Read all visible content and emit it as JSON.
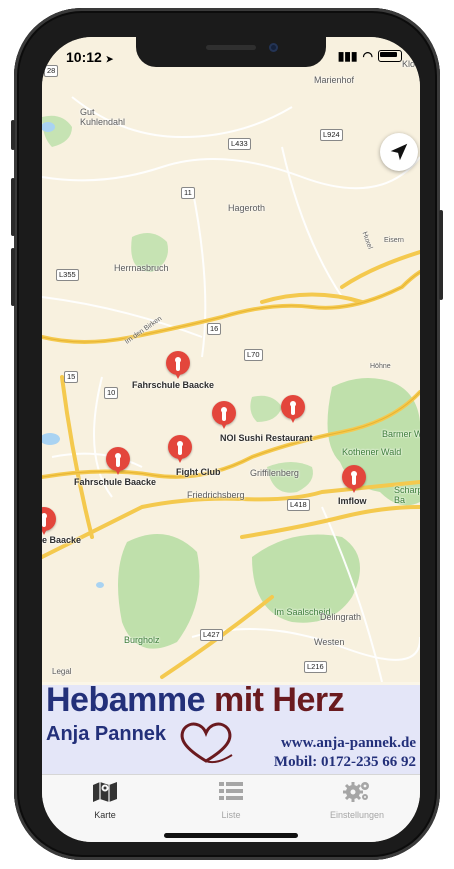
{
  "status_bar": {
    "time": "10:12",
    "location_arrow": "location-arrow-icon"
  },
  "map": {
    "places": [
      {
        "name": "Marienhof"
      },
      {
        "name": "Gut\nKuhlendahl"
      },
      {
        "name": "Hageroth"
      },
      {
        "name": "Herrnasbruch"
      },
      {
        "name": "Griffilenberg"
      },
      {
        "name": "Friedrichsberg"
      },
      {
        "name": "Kothener Wald"
      },
      {
        "name": "Barmer W"
      },
      {
        "name": "Im Saalscheid"
      },
      {
        "name": "Delingrath"
      },
      {
        "name": "Westen"
      },
      {
        "name": "Burgholz"
      },
      {
        "name": "Scharp\nBa"
      },
      {
        "name": "Klo"
      },
      {
        "name": "Legal"
      },
      {
        "name": "Huxel"
      },
      {
        "name": "Eisern"
      },
      {
        "name": "Höhne"
      },
      {
        "name": "Im den Birken"
      }
    ],
    "roads": [
      "28",
      "L924",
      "L433",
      "11",
      "L355",
      "16",
      "L70",
      "15",
      "10",
      "L418",
      "L427",
      "L216"
    ],
    "pins": [
      {
        "label": "Fahrschule Baacke"
      },
      {
        "label": "NOI Sushi Restaurant"
      },
      {
        "label": "Fight Club"
      },
      {
        "label": "Fahrschule Baacke"
      },
      {
        "label": "Imflow"
      },
      {
        "label": "e Baacke"
      }
    ]
  },
  "banner": {
    "title_part1": "Hebamme",
    "title_part2": "mit Herz",
    "name": "Anja Pannek",
    "website": "www.anja-pannek.de",
    "phone": "Mobil: 0172-235 66 92"
  },
  "tabs": [
    {
      "label": "Karte",
      "icon": "map-icon",
      "active": true
    },
    {
      "label": "Liste",
      "icon": "list-icon",
      "active": false
    },
    {
      "label": "Einstellungen",
      "icon": "gears-icon",
      "active": false
    }
  ],
  "colors": {
    "pin": "#e3463c",
    "banner_blue": "#23307a",
    "banner_red": "#6a1a1f",
    "tab_active": "#333333",
    "tab_inactive": "#a6a6a6"
  }
}
